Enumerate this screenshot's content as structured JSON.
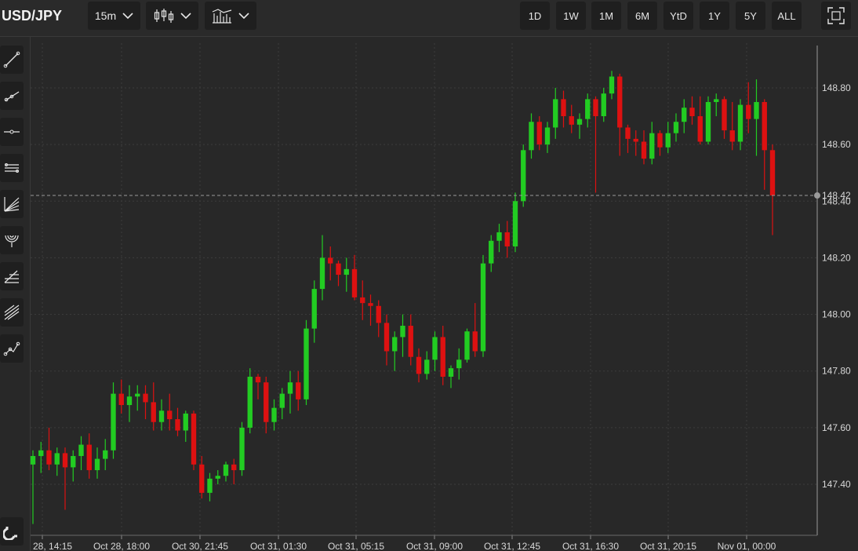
{
  "header": {
    "symbol": "USD/JPY",
    "interval": "15m",
    "ranges": [
      "1D",
      "1W",
      "1M",
      "6M",
      "YtD",
      "1Y",
      "5Y",
      "ALL"
    ],
    "icons": {
      "chart_type": "candlestick-icon",
      "indicators": "indicators-icon",
      "fullscreen": "fullscreen-icon"
    }
  },
  "sidebar": {
    "tools": [
      "trend-line-icon",
      "ray-icon",
      "horizontal-line-icon",
      "parallel-channel-icon",
      "fib-fan-icon",
      "fib-arcs-icon",
      "fib-retracement-icon",
      "pitchfork-icon",
      "path-icon"
    ],
    "bottom_tool": "magnet-icon"
  },
  "colors": {
    "up": "#22cc22",
    "down": "#dd1111",
    "background": "#282828",
    "grid": "#3c3c3c"
  },
  "chart_data": {
    "type": "candlestick",
    "instrument": "USD/JPY",
    "interval": "15m",
    "ylim": [
      147.22,
      148.98
    ],
    "y_ticks": [
      147.4,
      147.6,
      147.8,
      148.0,
      148.2,
      148.4,
      148.6,
      148.8
    ],
    "x_ticks": [
      "28, 14:15",
      "Oct 28, 18:00",
      "Oct 30, 21:45",
      "Oct 31, 01:30",
      "Oct 31, 05:15",
      "Oct 31, 09:00",
      "Oct 31, 12:45",
      "Oct 31, 16:30",
      "Oct 31, 20:15",
      "Nov 01, 00:00"
    ],
    "current_price": 148.42,
    "current_price_label": "148.42",
    "grid": true,
    "candles": [
      [
        147.47,
        147.52,
        147.26,
        147.5
      ],
      [
        147.5,
        147.55,
        147.44,
        147.52
      ],
      [
        147.52,
        147.6,
        147.45,
        147.47
      ],
      [
        147.47,
        147.53,
        147.43,
        147.51
      ],
      [
        147.51,
        147.53,
        147.31,
        147.46
      ],
      [
        147.46,
        147.52,
        147.41,
        147.5
      ],
      [
        147.5,
        147.57,
        147.45,
        147.54
      ],
      [
        147.54,
        147.58,
        147.42,
        147.45
      ],
      [
        147.45,
        147.53,
        147.42,
        147.49
      ],
      [
        147.49,
        147.56,
        147.45,
        147.52
      ],
      [
        147.52,
        147.76,
        147.49,
        147.72
      ],
      [
        147.72,
        147.77,
        147.65,
        147.68
      ],
      [
        147.68,
        147.75,
        147.62,
        147.71
      ],
      [
        147.71,
        147.75,
        147.66,
        147.72
      ],
      [
        147.72,
        147.75,
        147.63,
        147.69
      ],
      [
        147.69,
        147.76,
        147.59,
        147.62
      ],
      [
        147.62,
        147.7,
        147.59,
        147.66
      ],
      [
        147.66,
        147.72,
        147.59,
        147.63
      ],
      [
        147.63,
        147.67,
        147.57,
        147.59
      ],
      [
        147.59,
        147.66,
        147.55,
        147.65
      ],
      [
        147.65,
        147.66,
        147.45,
        147.47
      ],
      [
        147.47,
        147.5,
        147.35,
        147.37
      ],
      [
        147.37,
        147.44,
        147.34,
        147.42
      ],
      [
        147.42,
        147.45,
        147.4,
        147.43
      ],
      [
        147.43,
        147.48,
        147.41,
        147.47
      ],
      [
        147.47,
        147.49,
        147.4,
        147.45
      ],
      [
        147.45,
        147.62,
        147.43,
        147.6
      ],
      [
        147.6,
        147.81,
        147.58,
        147.78
      ],
      [
        147.78,
        147.79,
        147.7,
        147.76
      ],
      [
        147.76,
        147.78,
        147.58,
        147.62
      ],
      [
        147.62,
        147.7,
        147.59,
        147.67
      ],
      [
        147.67,
        147.74,
        147.63,
        147.72
      ],
      [
        147.72,
        147.8,
        147.65,
        147.76
      ],
      [
        147.76,
        147.8,
        147.66,
        147.7
      ],
      [
        147.7,
        147.98,
        147.68,
        147.95
      ],
      [
        147.95,
        148.12,
        147.9,
        148.09
      ],
      [
        148.09,
        148.28,
        148.05,
        148.2
      ],
      [
        148.2,
        148.24,
        148.12,
        148.18
      ],
      [
        148.18,
        148.19,
        148.1,
        148.14
      ],
      [
        148.14,
        148.2,
        148.08,
        148.16
      ],
      [
        148.16,
        148.21,
        148.05,
        148.06
      ],
      [
        148.06,
        148.12,
        147.98,
        148.04
      ],
      [
        148.04,
        148.07,
        147.96,
        148.03
      ],
      [
        148.03,
        148.05,
        147.92,
        147.97
      ],
      [
        147.97,
        148.0,
        147.82,
        147.87
      ],
      [
        147.87,
        147.94,
        147.8,
        147.92
      ],
      [
        147.92,
        148.0,
        147.85,
        147.96
      ],
      [
        147.96,
        148.0,
        147.82,
        147.85
      ],
      [
        147.85,
        147.88,
        147.76,
        147.79
      ],
      [
        147.79,
        147.87,
        147.77,
        147.84
      ],
      [
        147.84,
        147.94,
        147.8,
        147.92
      ],
      [
        147.92,
        147.96,
        147.75,
        147.78
      ],
      [
        147.78,
        147.82,
        147.74,
        147.81
      ],
      [
        147.81,
        147.88,
        147.77,
        147.84
      ],
      [
        147.84,
        147.95,
        147.83,
        147.94
      ],
      [
        147.94,
        148.04,
        147.85,
        147.87
      ],
      [
        147.87,
        148.21,
        147.85,
        148.18
      ],
      [
        148.18,
        148.28,
        148.15,
        148.26
      ],
      [
        148.26,
        148.32,
        148.22,
        148.29
      ],
      [
        148.29,
        148.33,
        148.2,
        148.24
      ],
      [
        148.24,
        148.43,
        148.22,
        148.4
      ],
      [
        148.4,
        148.6,
        148.38,
        148.58
      ],
      [
        148.58,
        148.71,
        148.55,
        148.68
      ],
      [
        148.68,
        148.7,
        148.58,
        148.6
      ],
      [
        148.6,
        148.68,
        148.57,
        148.66
      ],
      [
        148.66,
        148.8,
        148.62,
        148.76
      ],
      [
        148.76,
        148.79,
        148.66,
        148.7
      ],
      [
        148.7,
        148.74,
        148.64,
        148.67
      ],
      [
        148.67,
        148.71,
        148.62,
        148.69
      ],
      [
        148.69,
        148.78,
        148.66,
        148.76
      ],
      [
        148.76,
        148.77,
        148.43,
        148.7
      ],
      [
        148.7,
        148.8,
        148.68,
        148.78
      ],
      [
        148.78,
        148.86,
        148.76,
        148.84
      ],
      [
        148.84,
        148.85,
        148.56,
        148.66
      ],
      [
        148.66,
        148.67,
        148.57,
        148.62
      ],
      [
        148.62,
        148.65,
        148.56,
        148.61
      ],
      [
        148.61,
        148.65,
        148.53,
        148.55
      ],
      [
        148.55,
        148.68,
        148.53,
        148.64
      ],
      [
        148.64,
        148.65,
        148.56,
        148.59
      ],
      [
        148.59,
        148.68,
        148.57,
        148.64
      ],
      [
        148.64,
        148.71,
        148.61,
        148.68
      ],
      [
        148.68,
        148.76,
        148.64,
        148.73
      ],
      [
        148.73,
        148.77,
        148.67,
        148.7
      ],
      [
        148.7,
        148.77,
        148.6,
        148.61
      ],
      [
        148.61,
        148.77,
        148.6,
        148.75
      ],
      [
        148.75,
        148.78,
        148.7,
        148.76
      ],
      [
        148.76,
        148.77,
        148.62,
        148.65
      ],
      [
        148.65,
        148.75,
        148.58,
        148.61
      ],
      [
        148.61,
        148.76,
        148.58,
        148.74
      ],
      [
        148.74,
        148.82,
        148.64,
        148.69
      ],
      [
        148.69,
        148.83,
        148.56,
        148.75
      ],
      [
        148.75,
        148.76,
        148.44,
        148.58
      ],
      [
        148.58,
        148.6,
        148.28,
        148.42
      ]
    ]
  }
}
